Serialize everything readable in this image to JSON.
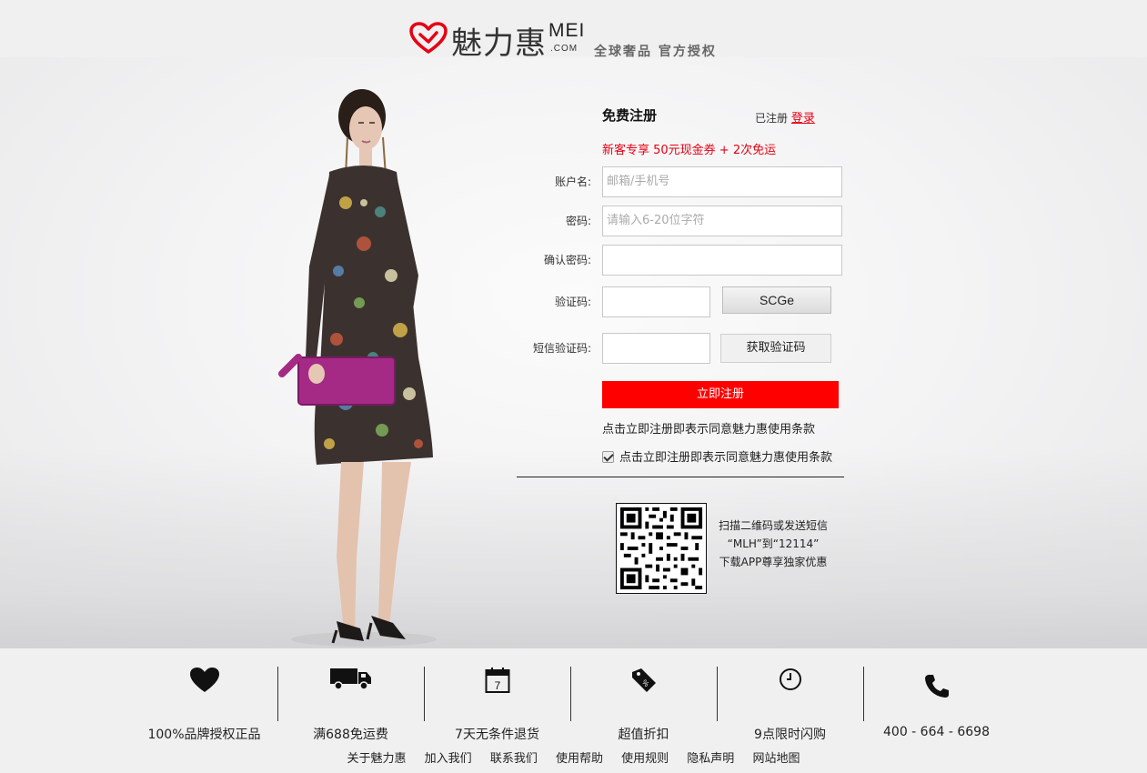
{
  "header": {
    "brand_cn": "魅力惠",
    "brand_en": "MEI",
    "brand_com": ".COM",
    "slogan": "全球奢品 官方授权"
  },
  "register": {
    "title": "免费注册",
    "registered_hint": "已注册",
    "login_link": "登录",
    "promo": "新客专享 50元现金券 + 2次免运",
    "fields": {
      "account_label": "账户名:",
      "account_placeholder": "邮箱/手机号",
      "password_label": "密码:",
      "password_placeholder": "请输入6-20位字符",
      "confirm_label": "确认密码:",
      "captcha_label": "验证码:",
      "captcha_value": "SCGe",
      "sms_label": "短信验证码:",
      "sms_button": "获取验证码"
    },
    "submit": "立即注册",
    "terms_note": "点击立即注册即表示同意魅力惠使用条款",
    "agree_label": "点击立即注册即表示同意魅力惠使用条款",
    "agree_checked": true
  },
  "app_promo": {
    "line1": "扫描二维码或发送短信",
    "line2": "“MLH”到“12114”",
    "line3": "下载APP尊享独家优惠"
  },
  "features": [
    {
      "icon": "heart-icon",
      "label": "100%品牌授权正品"
    },
    {
      "icon": "truck-icon",
      "label": "满688免运费"
    },
    {
      "icon": "calendar-icon",
      "label": "7天无条件退货",
      "icon_text": "7"
    },
    {
      "icon": "discount-tag-icon",
      "label": "超值折扣"
    },
    {
      "icon": "clock-icon",
      "label": "9点限时闪购"
    },
    {
      "icon": "phone-icon",
      "label": "400 - 664 - 6698"
    }
  ],
  "footer_links": [
    "关于魅力惠",
    "加入我们",
    "联系我们",
    "使用帮助",
    "使用规则",
    "隐私声明",
    "网站地图"
  ],
  "colors": {
    "brand_red": "#e60012",
    "button_red": "#fe0000",
    "background": "#f0f0f0"
  }
}
